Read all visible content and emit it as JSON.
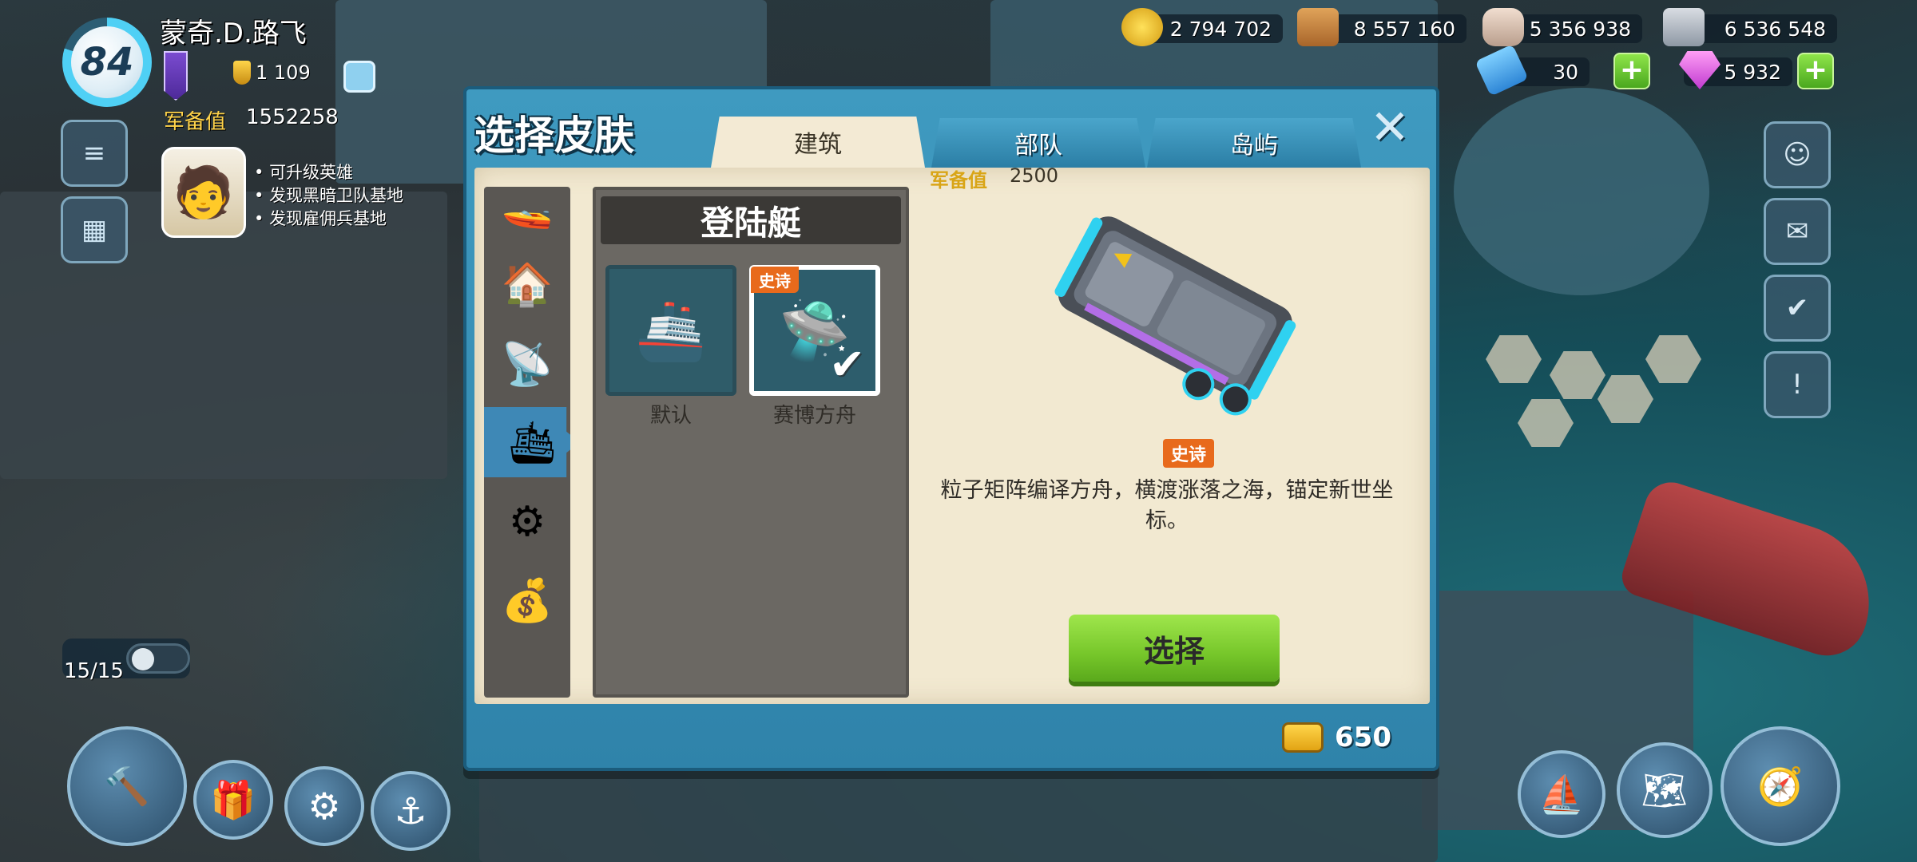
{
  "player": {
    "level": "84",
    "name": "蒙奇.D.路飞",
    "medals": "1 109",
    "power_label": "军备值",
    "power_value": "1552258",
    "notes": [
      "可升级英雄",
      "发现黑暗卫队基地",
      "发现雇佣兵基地"
    ]
  },
  "resources": {
    "gold": "2 794 702",
    "wood": "8 557 160",
    "stone": "5 356 938",
    "iron": "6 536 548",
    "tickets": "30",
    "diamonds": "5 932"
  },
  "counter": {
    "value": "15/15"
  },
  "modal": {
    "title": "选择皮肤",
    "tabs": [
      "建筑",
      "部队",
      "岛屿"
    ],
    "active_tab": "建筑",
    "panel_title": "登陆艇",
    "skins": [
      {
        "label": "默认",
        "tag": ""
      },
      {
        "label": "赛博方舟",
        "tag": "史诗"
      }
    ],
    "detail": {
      "power_label": "军备值",
      "power_value": "2500",
      "rarity": "史诗",
      "description": "粒子矩阵编译方舟，横渡涨落之海，锚定新世坐标。"
    },
    "select_label": "选择",
    "cost": "650"
  },
  "colors": {
    "modal_blue": "#3f9ac0",
    "paper": "#f2e9d1",
    "epic_orange": "#e86a1c",
    "select_green": "#76c62a",
    "power_gold": "#ffd34a"
  },
  "icons": {
    "gold": "gold-coin-icon",
    "wood": "wood-plank-icon",
    "stone": "stone-icon",
    "iron": "iron-ingot-icon",
    "tickets": "ticket-icon",
    "diamonds": "diamond-icon",
    "close": "close-icon",
    "check": "checkmark-icon"
  }
}
